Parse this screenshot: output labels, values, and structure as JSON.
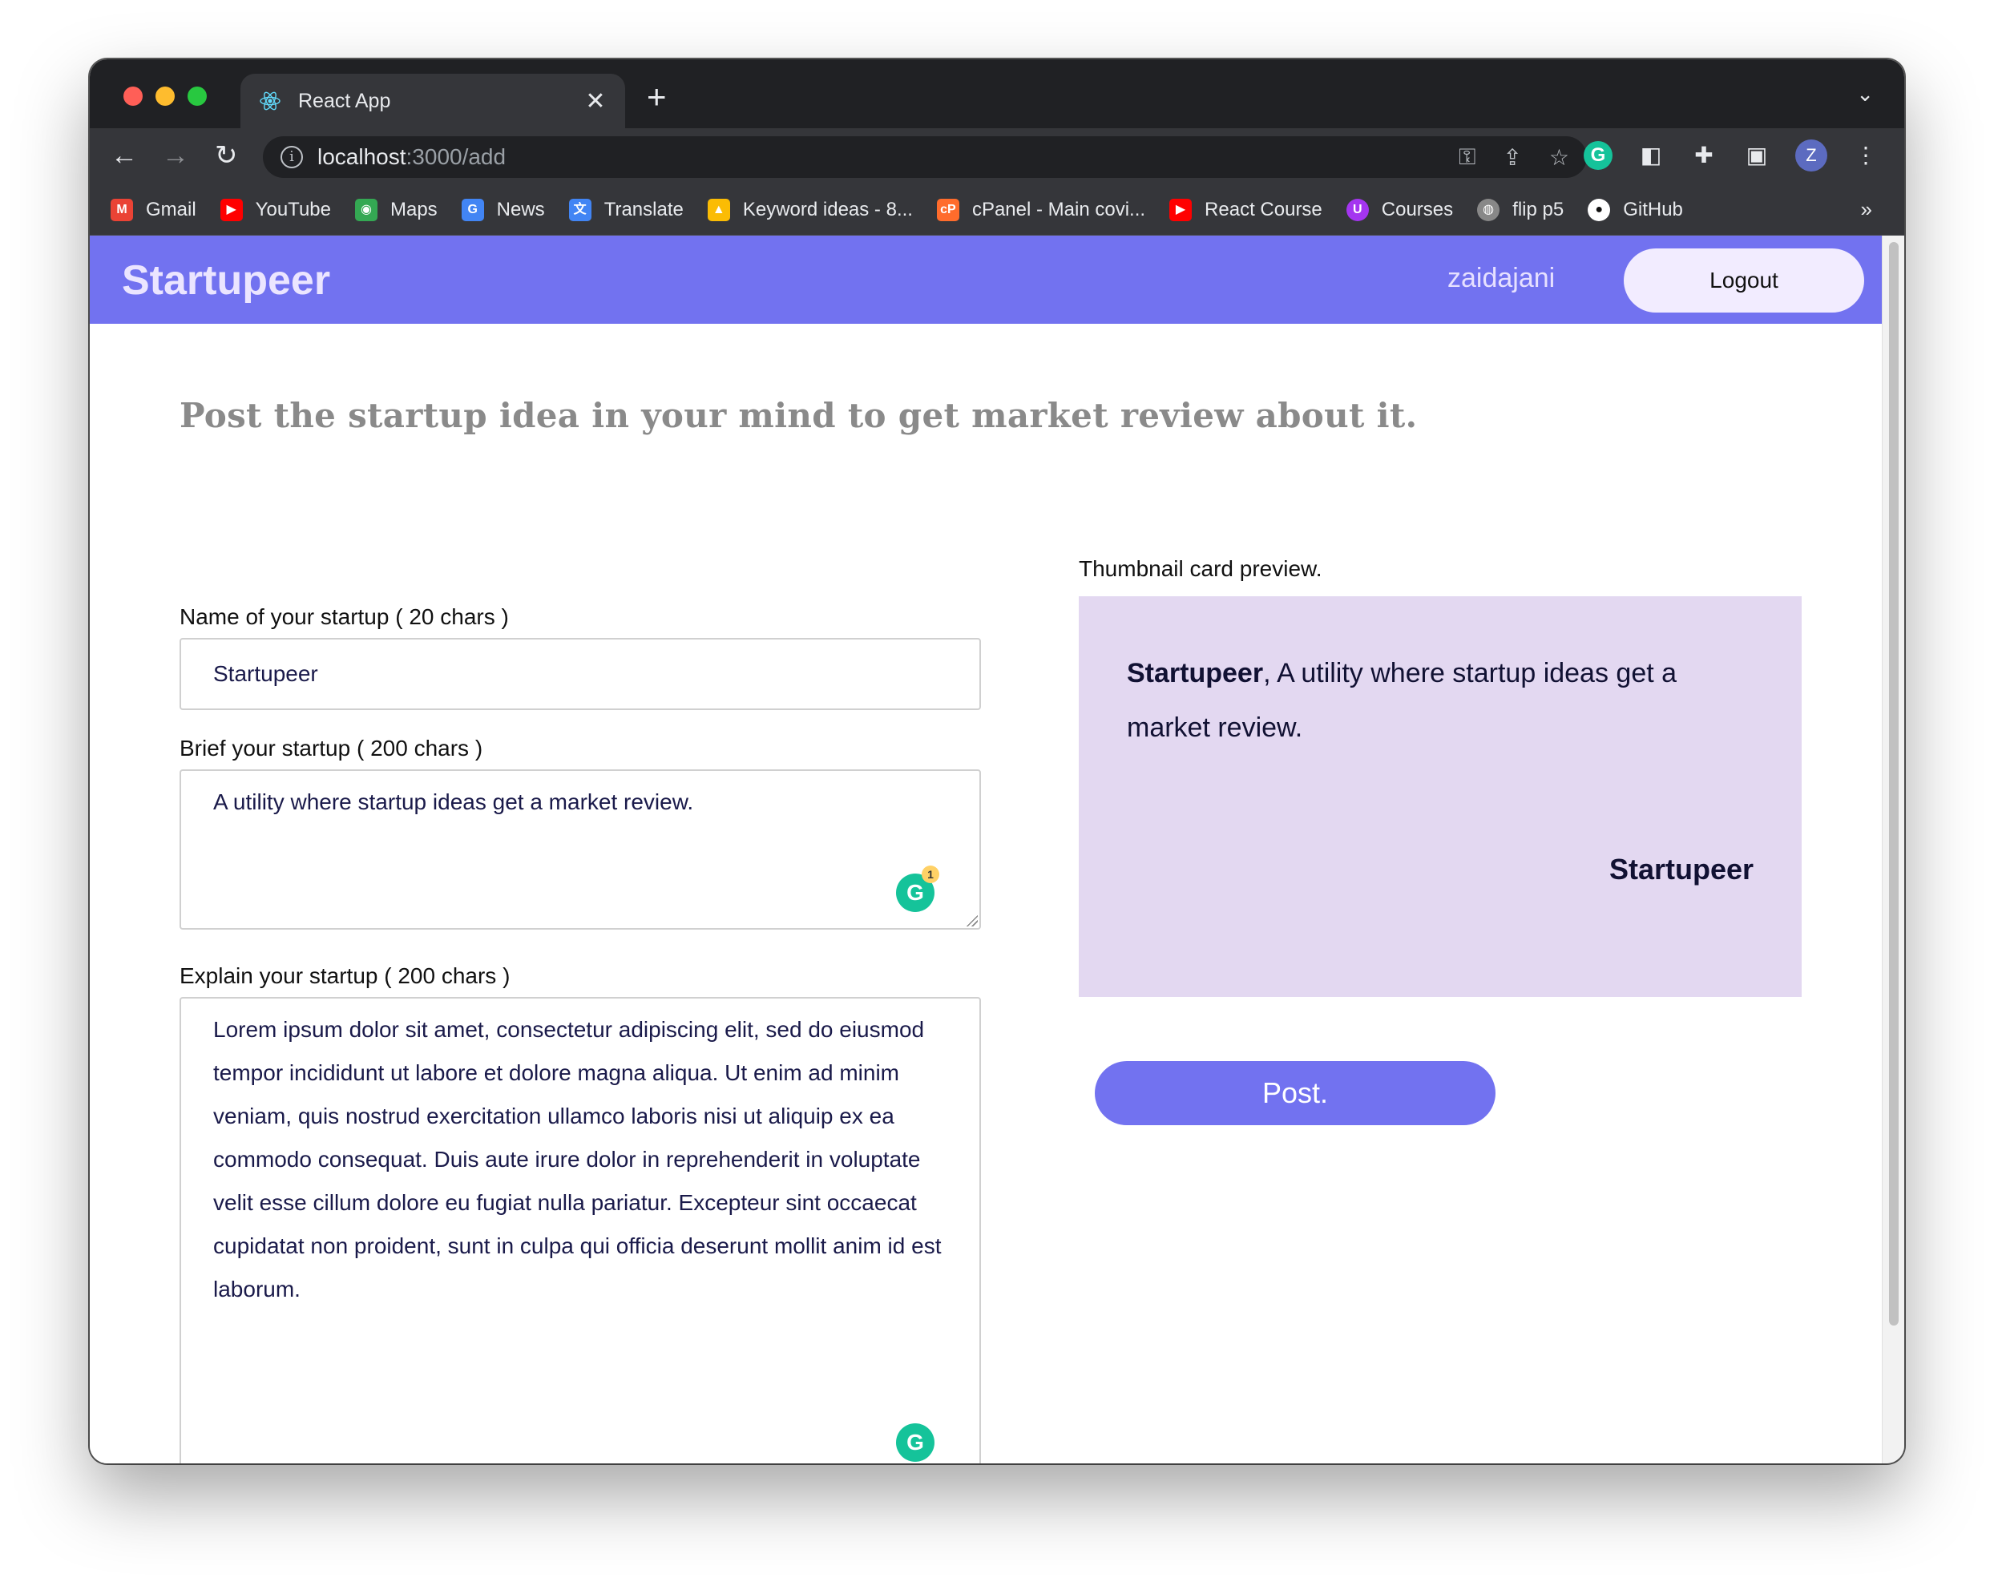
{
  "browser": {
    "tab_title": "React App",
    "url_host": "localhost",
    "url_path": ":3000/add",
    "profile_initial": "Z",
    "bookmarks": [
      {
        "label": "Gmail",
        "icon": "gmail-icon",
        "color": "#ea4335"
      },
      {
        "label": "YouTube",
        "icon": "youtube-icon",
        "color": "#ff0000"
      },
      {
        "label": "Maps",
        "icon": "maps-icon",
        "color": "#34a853"
      },
      {
        "label": "News",
        "icon": "news-icon",
        "color": "#4285f4"
      },
      {
        "label": "Translate",
        "icon": "translate-icon",
        "color": "#4285f4"
      },
      {
        "label": "Keyword ideas - 8...",
        "icon": "google-ads-icon",
        "color": "#fbbc04"
      },
      {
        "label": "cPanel - Main covi...",
        "icon": "cpanel-icon",
        "color": "#ff6c2c"
      },
      {
        "label": "React Course",
        "icon": "youtube-icon",
        "color": "#ff0000"
      },
      {
        "label": "Courses",
        "icon": "udemy-icon",
        "color": "#a435f0"
      },
      {
        "label": "flip p5",
        "icon": "globe-icon",
        "color": "#888888"
      },
      {
        "label": "GitHub",
        "icon": "github-icon",
        "color": "#ffffff"
      }
    ]
  },
  "header": {
    "logo": "Startupeer",
    "username": "zaidajani",
    "logout_label": "Logout"
  },
  "page": {
    "heading": "Post the startup idea in your mind to get market review about it."
  },
  "form": {
    "name_label": "Name of your startup ( 20 chars )",
    "name_value": "Startupeer",
    "brief_label": "Brief your startup ( 200 chars )",
    "brief_value": "A utility where startup ideas get a market review.",
    "explain_label": "Explain your startup ( 200 chars )",
    "explain_value": "Lorem ipsum dolor sit amet, consectetur adipiscing elit, sed do eiusmod tempor incididunt ut labore et dolore magna aliqua. Ut enim ad minim veniam, quis nostrud exercitation ullamco laboris nisi ut aliquip ex ea commodo consequat. Duis aute irure dolor in reprehenderit in voluptate velit esse cillum dolore eu fugiat nulla pariatur. Excepteur sint occaecat cupidatat non proident, sunt in culpa qui officia deserunt mollit anim id est laborum.",
    "grammarly_badge_count": "1"
  },
  "preview": {
    "label": "Thumbnail card preview.",
    "card_name": "Startupeer",
    "card_sep": ", ",
    "card_brief": "A utility where startup ideas get a market review.",
    "card_author": "Startupeer"
  },
  "post_label": "Post.",
  "colors": {
    "brand": "#7272f0",
    "card_bg": "#e3d8f1"
  }
}
